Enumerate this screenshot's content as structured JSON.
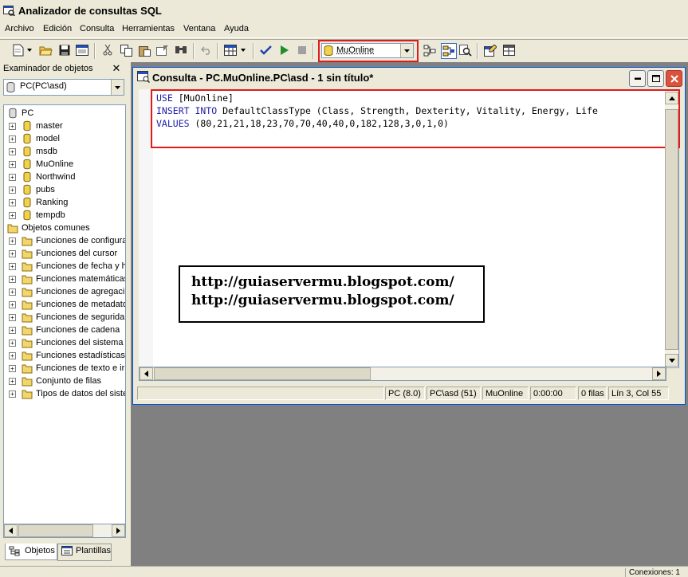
{
  "app": {
    "title": "Analizador de consultas SQL"
  },
  "menu": [
    "Archivo",
    "Edición",
    "Consulta",
    "Herramientas",
    "Ventana",
    "Ayuda"
  ],
  "toolbar": {
    "database_selected": "MuOnline"
  },
  "explorer": {
    "header": "Examinador de objetos",
    "server": "PC(PC\\asd)",
    "tree": [
      {
        "label": "PC",
        "type": "server",
        "level": 0,
        "expander": ""
      },
      {
        "label": "master",
        "type": "db",
        "level": 1,
        "expander": "+"
      },
      {
        "label": "model",
        "type": "db",
        "level": 1,
        "expander": "+"
      },
      {
        "label": "msdb",
        "type": "db",
        "level": 1,
        "expander": "+"
      },
      {
        "label": "MuOnline",
        "type": "db",
        "level": 1,
        "expander": "+"
      },
      {
        "label": "Northwind",
        "type": "db",
        "level": 1,
        "expander": "+"
      },
      {
        "label": "pubs",
        "type": "db",
        "level": 1,
        "expander": "+"
      },
      {
        "label": "Ranking",
        "type": "db",
        "level": 1,
        "expander": "+"
      },
      {
        "label": "tempdb",
        "type": "db",
        "level": 1,
        "expander": "+"
      },
      {
        "label": "Objetos comunes",
        "type": "folder",
        "level": 0,
        "expander": ""
      },
      {
        "label": "Funciones de configura",
        "type": "folder",
        "level": 1,
        "expander": "+"
      },
      {
        "label": "Funciones del cursor",
        "type": "folder",
        "level": 1,
        "expander": "+"
      },
      {
        "label": "Funciones de fecha y h",
        "type": "folder",
        "level": 1,
        "expander": "+"
      },
      {
        "label": "Funciones matemáticas",
        "type": "folder",
        "level": 1,
        "expander": "+"
      },
      {
        "label": "Funciones de agregaci",
        "type": "folder",
        "level": 1,
        "expander": "+"
      },
      {
        "label": "Funciones de metadato",
        "type": "folder",
        "level": 1,
        "expander": "+"
      },
      {
        "label": "Funciones de segurida",
        "type": "folder",
        "level": 1,
        "expander": "+"
      },
      {
        "label": "Funciones de cadena",
        "type": "folder",
        "level": 1,
        "expander": "+"
      },
      {
        "label": "Funciones del sistema",
        "type": "folder",
        "level": 1,
        "expander": "+"
      },
      {
        "label": "Funciones estadísticas",
        "type": "folder",
        "level": 1,
        "expander": "+"
      },
      {
        "label": "Funciones de texto e ir",
        "type": "folder",
        "level": 1,
        "expander": "+"
      },
      {
        "label": "Conjunto de filas",
        "type": "folder",
        "level": 1,
        "expander": "+"
      },
      {
        "label": "Tipos de datos del siste",
        "type": "folder",
        "level": 1,
        "expander": "+"
      }
    ],
    "tabs": [
      "Objetos",
      "Plantillas"
    ]
  },
  "query": {
    "window_title": "Consulta - PC.MuOnline.PC\\asd - 1 sin título*",
    "lines": [
      {
        "kw": "USE",
        "rest": " [MuOnline]"
      },
      {
        "kw": "INSERT INTO",
        "rest": " DefaultClassType (Class, Strength, Dexterity, Vitality, Energy, Life"
      },
      {
        "kw": "VALUES",
        "rest": " (80,21,21,18,23,70,70,40,40,0,182,128,3,0,1,0)"
      }
    ]
  },
  "watermark": [
    "http://guiaservermu.blogspot.com/",
    "http://guiaservermu.blogspot.com/"
  ],
  "status": {
    "server": "PC (8.0)",
    "login": "PC\\asd (51)",
    "database": "MuOnline",
    "time": "0:00:00",
    "rows": "0 filas",
    "position": "Lín 3, Col 55"
  },
  "app_status": {
    "connections": "Conexiones: 1"
  },
  "colors": {
    "highlight": "#e01b1b",
    "keyword": "#1c1ca8",
    "mdi_background": "#808080"
  }
}
